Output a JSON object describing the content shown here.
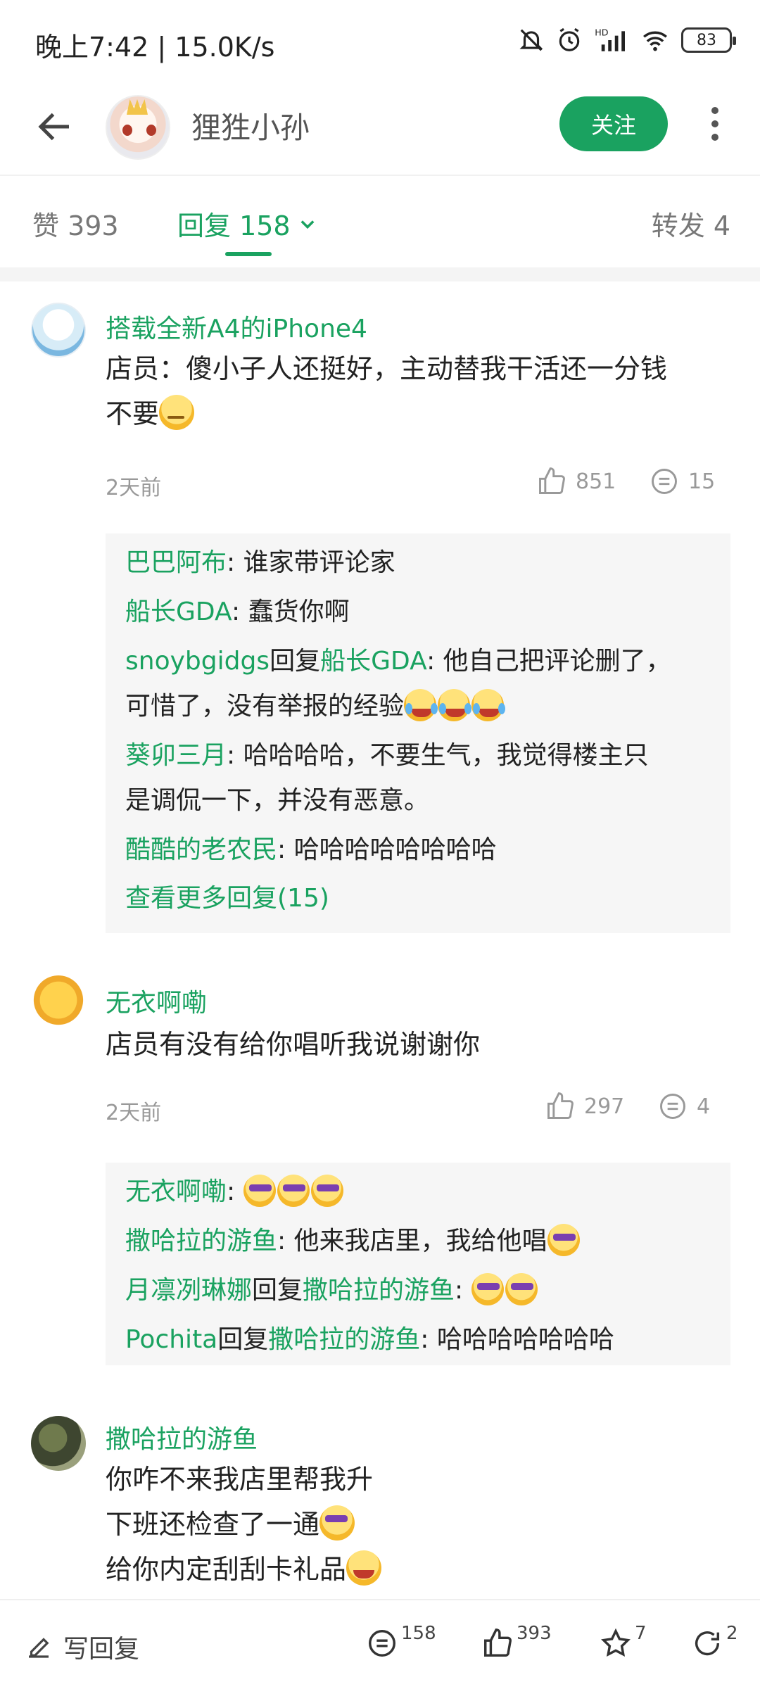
{
  "status_bar": {
    "time": "晚上7:42 | 15.0K/s",
    "battery": "83"
  },
  "header": {
    "user_name": "狸狌小孙",
    "follow_label": "关注"
  },
  "tabs": {
    "likes": "赞 393",
    "replies": "回复 158",
    "forwards": "转发 4"
  },
  "comments": [
    {
      "name": "搭载全新A4的iPhone4",
      "body_line1": "店员：傻小子人还挺好，主动替我干活还一分钱",
      "body_line2": "不要",
      "time": "2天前",
      "likes": "851",
      "replies": "15",
      "sub_replies": [
        {
          "user": "巴巴阿布",
          "sep": ": ",
          "text": "谁家带评论家"
        },
        {
          "user": "船长GDA",
          "sep": ": ",
          "text": "蠢货你啊"
        },
        {
          "user": "snoybgidgs",
          "mid": "回复",
          "target": "船长GDA",
          "sep": ": ",
          "text": "他自己把评论删了，",
          "text2": "可惜了，没有举报的经验"
        },
        {
          "user": "葵卯三月",
          "sep": ": ",
          "text": "哈哈哈哈，不要生气，我觉得楼主只",
          "text2": "是调侃一下，并没有恶意。"
        },
        {
          "user": "酷酷的老农民",
          "sep": ": ",
          "text": "哈哈哈哈哈哈哈哈"
        }
      ],
      "more_label": "查看更多回复(15)"
    },
    {
      "name": "无衣啊嘞",
      "body_line1": "店员有没有给你唱听我说谢谢你",
      "time": "2天前",
      "likes": "297",
      "replies": "4",
      "sub_replies": [
        {
          "user": "无衣啊嘞",
          "sep": ": "
        },
        {
          "user": "撒哈拉的游鱼",
          "sep": ": ",
          "text": "他来我店里，我给他唱"
        },
        {
          "user": "月凛冽琳娜",
          "mid": "回复",
          "target": "撒哈拉的游鱼",
          "sep": ": "
        },
        {
          "user": "Pochita",
          "mid": "回复",
          "target": "撒哈拉的游鱼",
          "sep": ": ",
          "text": "哈哈哈哈哈哈哈"
        }
      ]
    },
    {
      "name": "撒哈拉的游鱼",
      "body_line1": "你咋不来我店里帮我升",
      "body_line2": "下班还检查了一通",
      "body_line3": "给你内定刮刮卡礼品"
    }
  ],
  "bottom_bar": {
    "write_reply": "写回复",
    "comment_count": "158",
    "like_count": "393",
    "star_count": "7",
    "share_count": "2"
  },
  "colors": {
    "accent": "#1aa260",
    "muted": "#999999",
    "sub_bg": "#f6f6f6"
  },
  "icons": [
    "back-arrow-icon",
    "more-vertical-icon",
    "chevron-down-icon",
    "thumbs-up-icon",
    "comment-icon",
    "pencil-icon",
    "star-icon",
    "share-icon"
  ]
}
